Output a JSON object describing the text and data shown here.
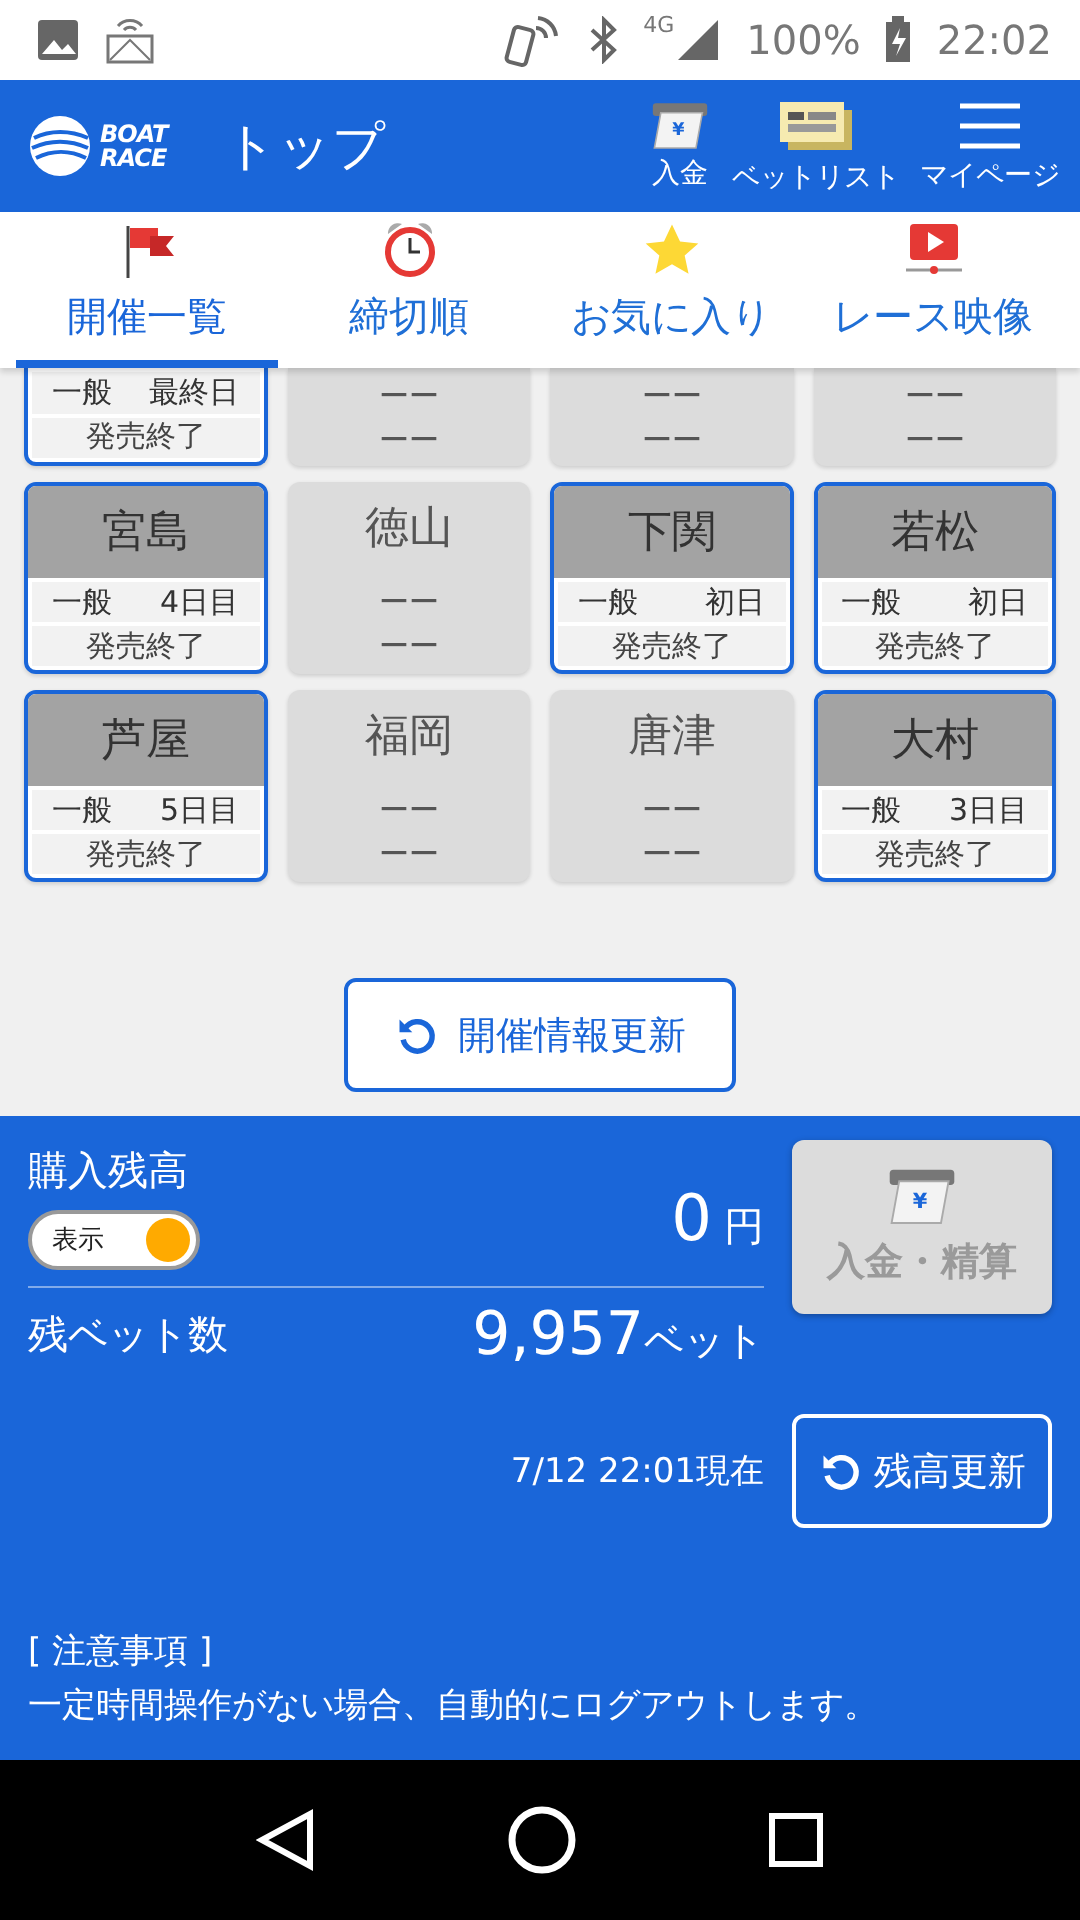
{
  "status_bar": {
    "network": "4G",
    "battery": "100%",
    "time": "22:02"
  },
  "header": {
    "logo_lines": [
      "BOAT",
      "RACE"
    ],
    "title": "トップ",
    "actions": [
      {
        "kind": "deposit",
        "label": "入金",
        "icon_glyph": "¥"
      },
      {
        "kind": "betlist",
        "label": "ベットリスト"
      },
      {
        "kind": "menu",
        "label": "マイページ"
      }
    ]
  },
  "tabs": [
    {
      "kind": "flag",
      "label": "開催一覧",
      "selected": true
    },
    {
      "kind": "clock",
      "label": "締切順",
      "selected": false
    },
    {
      "kind": "star",
      "label": "お気に入り",
      "selected": false
    },
    {
      "kind": "video",
      "label": "レース映像",
      "selected": false
    }
  ],
  "venues": [
    {
      "kind": "open",
      "grade": "一般",
      "day": "最終日",
      "status": "発売終了"
    },
    {
      "kind": "closed",
      "line_1": "ーー",
      "line_2": "ーー"
    },
    {
      "kind": "closed",
      "line_1": "ーー",
      "line_2": "ーー"
    },
    {
      "kind": "closed",
      "line_1": "ーー",
      "line_2": "ーー"
    },
    {
      "kind": "open",
      "name": "宮島",
      "grade": "一般",
      "day": "4日目",
      "status": "発売終了"
    },
    {
      "kind": "closed",
      "name": "徳山",
      "line_1": "ーー",
      "line_2": "ーー"
    },
    {
      "kind": "open",
      "name": "下関",
      "grade": "一般",
      "day": "初日",
      "status": "発売終了"
    },
    {
      "kind": "open",
      "name": "若松",
      "grade": "一般",
      "day": "初日",
      "status": "発売終了"
    },
    {
      "kind": "open",
      "name": "芦屋",
      "grade": "一般",
      "day": "5日目",
      "status": "発売終了"
    },
    {
      "kind": "closed",
      "name": "福岡",
      "line_1": "ーー",
      "line_2": "ーー"
    },
    {
      "kind": "closed",
      "name": "唐津",
      "line_1": "ーー",
      "line_2": "ーー"
    },
    {
      "kind": "open",
      "name": "大村",
      "grade": "一般",
      "day": "3日目",
      "status": "発売終了"
    }
  ],
  "refresh_button": "開催情報更新",
  "balance": {
    "label": "購入残高",
    "toggle": {
      "label": "表示",
      "on": true
    },
    "amount": "0",
    "unit": "円",
    "deposit_button": {
      "label": "入金・精算",
      "icon_glyph": "¥",
      "disabled": true
    },
    "bets_label": "残ベット数",
    "bets_value": "9,957",
    "bets_unit": "ベット",
    "timestamp": "7/12 22:01現在",
    "refresh_button": "残高更新",
    "notice_title": "[ 注意事項 ]",
    "notice_text": "一定時間操作がない場合、自動的にログアウトします。"
  }
}
